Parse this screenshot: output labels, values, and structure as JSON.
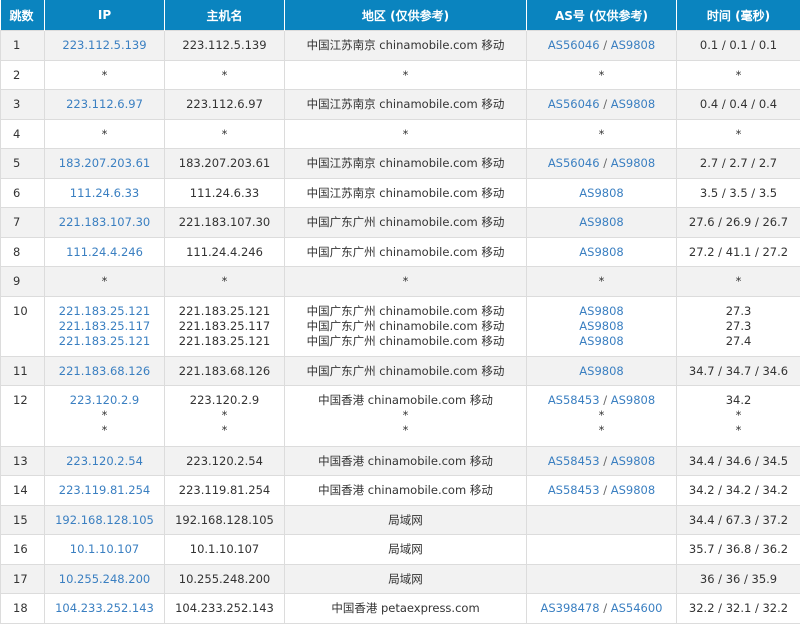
{
  "headers": {
    "hop": "跳数",
    "ip": "IP",
    "host": "主机名",
    "region": "地区 (仅供参考)",
    "as": "AS号 (仅供参考)",
    "time": "时间 (毫秒)"
  },
  "colors": {
    "header_bg": "#0a84bf",
    "link": "#3a7fc1",
    "row_alt": "#f2f2f2",
    "border": "#dcdcdc"
  },
  "rows": [
    {
      "hop": "1",
      "lines": [
        {
          "ip": "223.112.5.139",
          "host": "223.112.5.139",
          "region": "中国江苏南京 chinamobile.com 移动",
          "as": [
            "AS56046",
            "AS9808"
          ],
          "time": "0.1 / 0.1 / 0.1"
        }
      ]
    },
    {
      "hop": "2",
      "lines": [
        {
          "ip": "*",
          "host": "*",
          "region": "*",
          "as": [
            "*"
          ],
          "time": "*"
        }
      ]
    },
    {
      "hop": "3",
      "lines": [
        {
          "ip": "223.112.6.97",
          "host": "223.112.6.97",
          "region": "中国江苏南京 chinamobile.com 移动",
          "as": [
            "AS56046",
            "AS9808"
          ],
          "time": "0.4 / 0.4 / 0.4"
        }
      ]
    },
    {
      "hop": "4",
      "lines": [
        {
          "ip": "*",
          "host": "*",
          "region": "*",
          "as": [
            "*"
          ],
          "time": "*"
        }
      ]
    },
    {
      "hop": "5",
      "lines": [
        {
          "ip": "183.207.203.61",
          "host": "183.207.203.61",
          "region": "中国江苏南京 chinamobile.com 移动",
          "as": [
            "AS56046",
            "AS9808"
          ],
          "time": "2.7 / 2.7 / 2.7"
        }
      ]
    },
    {
      "hop": "6",
      "lines": [
        {
          "ip": "111.24.6.33",
          "host": "111.24.6.33",
          "region": "中国江苏南京 chinamobile.com 移动",
          "as": [
            "AS9808"
          ],
          "time": "3.5 / 3.5 / 3.5"
        }
      ]
    },
    {
      "hop": "7",
      "lines": [
        {
          "ip": "221.183.107.30",
          "host": "221.183.107.30",
          "region": "中国广东广州 chinamobile.com 移动",
          "as": [
            "AS9808"
          ],
          "time": "27.6 / 26.9 / 26.7"
        }
      ]
    },
    {
      "hop": "8",
      "lines": [
        {
          "ip": "111.24.4.246",
          "host": "111.24.4.246",
          "region": "中国广东广州 chinamobile.com 移动",
          "as": [
            "AS9808"
          ],
          "time": "27.2 / 41.1 / 27.2"
        }
      ]
    },
    {
      "hop": "9",
      "lines": [
        {
          "ip": "*",
          "host": "*",
          "region": "*",
          "as": [
            "*"
          ],
          "time": "*"
        }
      ]
    },
    {
      "hop": "10",
      "lines": [
        {
          "ip": "221.183.25.121",
          "host": "221.183.25.121",
          "region": "中国广东广州 chinamobile.com 移动",
          "as": [
            "AS9808"
          ],
          "time": "27.3"
        },
        {
          "ip": "221.183.25.117",
          "host": "221.183.25.117",
          "region": "中国广东广州 chinamobile.com 移动",
          "as": [
            "AS9808"
          ],
          "time": "27.3"
        },
        {
          "ip": "221.183.25.121",
          "host": "221.183.25.121",
          "region": "中国广东广州 chinamobile.com 移动",
          "as": [
            "AS9808"
          ],
          "time": "27.4"
        }
      ]
    },
    {
      "hop": "11",
      "lines": [
        {
          "ip": "221.183.68.126",
          "host": "221.183.68.126",
          "region": "中国广东广州 chinamobile.com 移动",
          "as": [
            "AS9808"
          ],
          "time": "34.7 / 34.7 / 34.6"
        }
      ]
    },
    {
      "hop": "12",
      "lines": [
        {
          "ip": "223.120.2.9",
          "host": "223.120.2.9",
          "region": "中国香港 chinamobile.com 移动",
          "as": [
            "AS58453",
            "AS9808"
          ],
          "time": "34.2"
        },
        {
          "ip": "*",
          "host": "*",
          "region": "*",
          "as": [
            "*"
          ],
          "time": "*"
        },
        {
          "ip": "*",
          "host": "*",
          "region": "*",
          "as": [
            "*"
          ],
          "time": "*"
        }
      ]
    },
    {
      "hop": "13",
      "lines": [
        {
          "ip": "223.120.2.54",
          "host": "223.120.2.54",
          "region": "中国香港 chinamobile.com 移动",
          "as": [
            "AS58453",
            "AS9808"
          ],
          "time": "34.4 / 34.6 / 34.5"
        }
      ]
    },
    {
      "hop": "14",
      "lines": [
        {
          "ip": "223.119.81.254",
          "host": "223.119.81.254",
          "region": "中国香港 chinamobile.com 移动",
          "as": [
            "AS58453",
            "AS9808"
          ],
          "time": "34.2 / 34.2 / 34.2"
        }
      ]
    },
    {
      "hop": "15",
      "lines": [
        {
          "ip": "192.168.128.105",
          "host": "192.168.128.105",
          "region": "局域网",
          "as": [],
          "time": "34.4 / 67.3 / 37.2"
        }
      ]
    },
    {
      "hop": "16",
      "lines": [
        {
          "ip": "10.1.10.107",
          "host": "10.1.10.107",
          "region": "局域网",
          "as": [],
          "time": "35.7 / 36.8 / 36.2"
        }
      ]
    },
    {
      "hop": "17",
      "lines": [
        {
          "ip": "10.255.248.200",
          "host": "10.255.248.200",
          "region": "局域网",
          "as": [],
          "time": "36 / 36 / 35.9"
        }
      ]
    },
    {
      "hop": "18",
      "lines": [
        {
          "ip": "104.233.252.143",
          "host": "104.233.252.143",
          "region": "中国香港 petaexpress.com",
          "as": [
            "AS398478",
            "AS54600"
          ],
          "time": "32.2 / 32.1 / 32.2"
        }
      ]
    }
  ]
}
